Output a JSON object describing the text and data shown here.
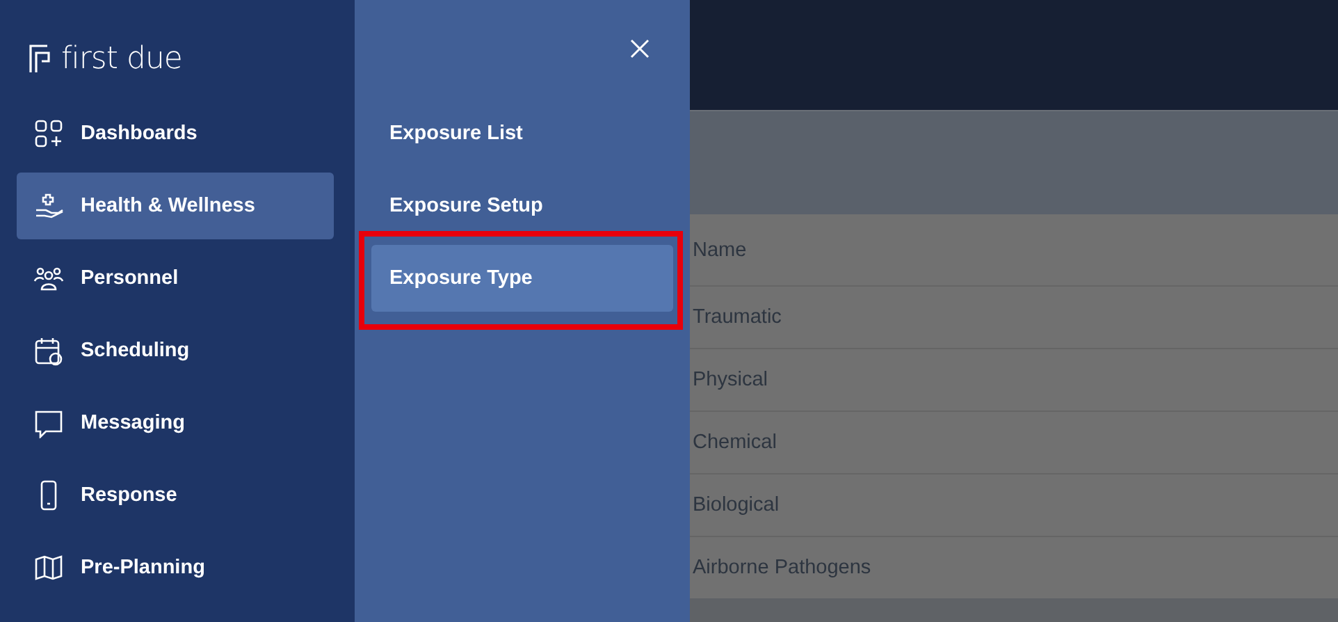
{
  "logo": {
    "text": "first due"
  },
  "sidebar": {
    "items": [
      {
        "label": "Dashboards",
        "selected": false
      },
      {
        "label": "Health & Wellness",
        "selected": true
      },
      {
        "label": "Personnel",
        "selected": false
      },
      {
        "label": "Scheduling",
        "selected": false
      },
      {
        "label": "Messaging",
        "selected": false
      },
      {
        "label": "Response",
        "selected": false
      },
      {
        "label": "Pre-Planning",
        "selected": false
      }
    ]
  },
  "submenu": {
    "items": [
      {
        "label": "Exposure List",
        "selected": false
      },
      {
        "label": "Exposure Setup",
        "selected": false
      },
      {
        "label": "Exposure Type",
        "selected": true
      }
    ]
  },
  "table": {
    "columns": [
      "Name"
    ],
    "rows": [
      [
        "Traumatic"
      ],
      [
        "Physical"
      ],
      [
        "Chemical"
      ],
      [
        "Biological"
      ],
      [
        "Airborne Pathogens"
      ]
    ]
  }
}
